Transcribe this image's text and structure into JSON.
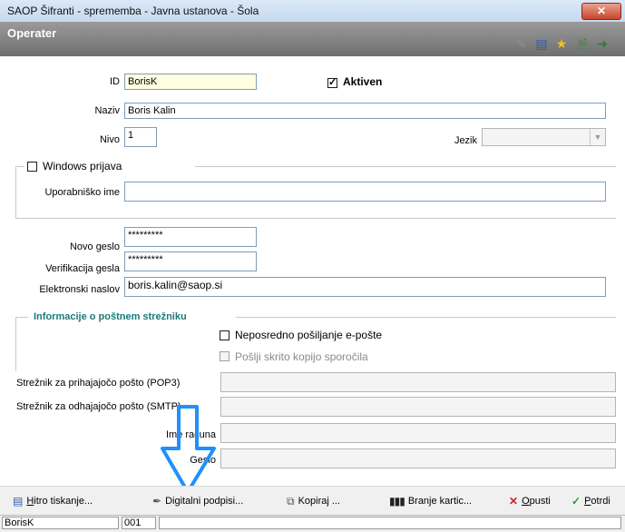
{
  "window": {
    "title": "SAOP Šifranti - sprememba - Javna ustanova - Šola",
    "close_glyph": "✕"
  },
  "header": {
    "title": "Operater"
  },
  "toolbar_icons": [
    "edit-icon",
    "columns-icon",
    "star-icon",
    "document-icon",
    "exit-icon"
  ],
  "form": {
    "id_label": "ID",
    "id_value": "BorisK",
    "aktiven_label": "Aktiven",
    "aktiven_checked": true,
    "naziv_label": "Naziv",
    "naziv_value": "Boris Kalin",
    "nivo_label": "Nivo",
    "nivo_value": "1",
    "jezik_label": "Jezik",
    "jezik_value": ""
  },
  "windows": {
    "checkbox_label": "Windows prijava",
    "checked": false,
    "username_label": "Uporabniško ime",
    "username_value": ""
  },
  "password": {
    "new_label": "Novo geslo",
    "new_value": "*********",
    "verify_label": "Verifikacija gesla",
    "verify_value": "*********",
    "email_label": "Elektronski naslov",
    "email_value": "boris.kalin@saop.si"
  },
  "mail": {
    "section_title": "Informacije o poštnem strežniku",
    "direct_send_label": "Neposredno pošiljanje e-pošte",
    "direct_send_checked": false,
    "bcc_label": "Pošlji skrito kopijo sporočila",
    "bcc_checked": false,
    "pop3_label": "Strežnik za prihajajočo pošto (POP3)",
    "pop3_value": "",
    "smtp_label": "Strežnik za odhajajočo pošto (SMTP)",
    "smtp_value": "",
    "account_label": "Ime računa",
    "account_value": "",
    "password_label": "Geslo",
    "password_value": ""
  },
  "buttons": {
    "quick_print": {
      "prefix": "",
      "hot": "H",
      "rest": "itro tiskanje..."
    },
    "digital_sign": {
      "label": "Digitalni podpisi..."
    },
    "copy": {
      "label": "Kopiraj ..."
    },
    "read_card": {
      "label": "Branje kartic..."
    },
    "cancel": {
      "hot": "O",
      "rest": "pusti"
    },
    "confirm": {
      "hot": "P",
      "rest": "otrdi"
    }
  },
  "status": {
    "user": "BorisK",
    "code": "001",
    "extra": ""
  },
  "colors": {
    "section_title": "#1a7a7a",
    "arrow": "#1e90ff",
    "id_field_bg": "#ffffe1"
  }
}
